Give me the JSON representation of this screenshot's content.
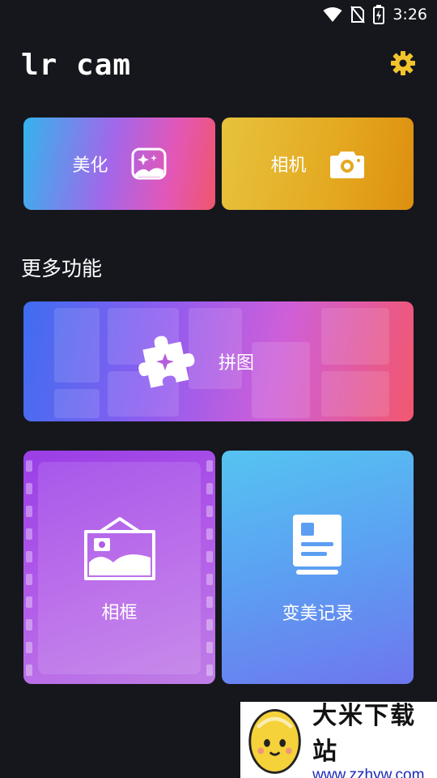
{
  "status_bar": {
    "time": "3:26",
    "icons": [
      "wifi-icon",
      "no-sim-icon",
      "battery-charging-icon"
    ]
  },
  "header": {
    "title": "lr cam",
    "settings_icon": "gear-icon"
  },
  "top_cards": [
    {
      "label": "美化",
      "icon": "sparkle-image-icon"
    },
    {
      "label": "相机",
      "icon": "camera-icon"
    }
  ],
  "section": {
    "title": "更多功能"
  },
  "features": {
    "collage": {
      "label": "拼图",
      "icon": "puzzle-icon"
    },
    "frame": {
      "label": "相框",
      "icon": "picture-frame-icon"
    },
    "records": {
      "label": "变美记录",
      "icon": "document-icon"
    }
  },
  "watermark": {
    "brand": "大米下载站",
    "url": "www.zzhyw.com",
    "logo": "egg-mascot-icon"
  },
  "colors": {
    "background": "#16171d",
    "settings_gear": "#f2c42c",
    "camera_card": "#e4a820"
  }
}
